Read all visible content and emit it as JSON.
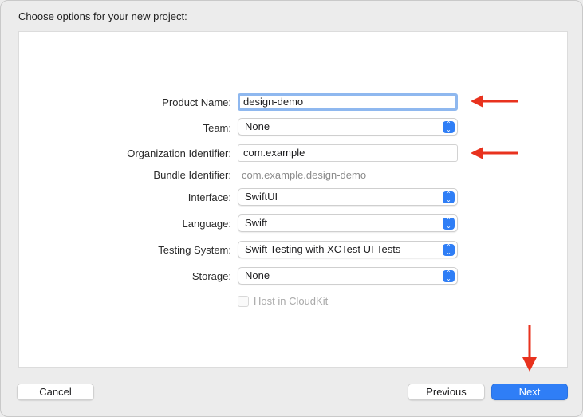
{
  "dialog": {
    "title": "Choose options for your new project:"
  },
  "form": {
    "product_name": {
      "label": "Product Name:",
      "value": "design-demo"
    },
    "team": {
      "label": "Team:",
      "value": "None"
    },
    "organization_identifier": {
      "label": "Organization Identifier:",
      "value": "com.example"
    },
    "bundle_identifier": {
      "label": "Bundle Identifier:",
      "value": "com.example.design-demo"
    },
    "interface": {
      "label": "Interface:",
      "value": "SwiftUI"
    },
    "language": {
      "label": "Language:",
      "value": "Swift"
    },
    "testing_system": {
      "label": "Testing System:",
      "value": "Swift Testing with XCTest UI Tests"
    },
    "storage": {
      "label": "Storage:",
      "value": "None"
    },
    "host_in_cloudkit": {
      "label": "Host in CloudKit",
      "checked": false,
      "enabled": false
    }
  },
  "buttons": {
    "cancel": "Cancel",
    "previous": "Previous",
    "next": "Next"
  },
  "colors": {
    "accent": "#2f7ef6",
    "annotation_arrow": "#e8321e"
  }
}
